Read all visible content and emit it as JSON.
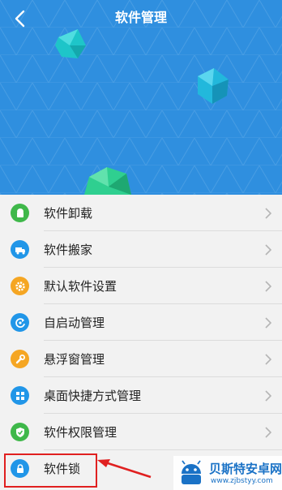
{
  "header": {
    "title": "软件管理",
    "back_icon": "chevron-left-icon",
    "background_color": "#2f8fdf"
  },
  "menu": {
    "items": [
      {
        "label": "软件卸载",
        "icon": "android-icon",
        "color": "#3fb84a"
      },
      {
        "label": "软件搬家",
        "icon": "truck-icon",
        "color": "#2196e8"
      },
      {
        "label": "默认软件设置",
        "icon": "gear-icon",
        "color": "#f5a623"
      },
      {
        "label": "自启动管理",
        "icon": "power-cycle-icon",
        "color": "#2196e8"
      },
      {
        "label": "悬浮窗管理",
        "icon": "wrench-icon",
        "color": "#f5a623"
      },
      {
        "label": "桌面快捷方式管理",
        "icon": "grid-icon",
        "color": "#2196e8"
      },
      {
        "label": "软件权限管理",
        "icon": "shield-check-icon",
        "color": "#3fb84a"
      },
      {
        "label": "软件锁",
        "icon": "lock-icon",
        "color": "#2196e8"
      }
    ]
  },
  "annotation": {
    "highlight_color": "#e02020"
  },
  "watermark": {
    "title": "贝斯特安卓网",
    "url": "www.zjbstyy.com"
  }
}
